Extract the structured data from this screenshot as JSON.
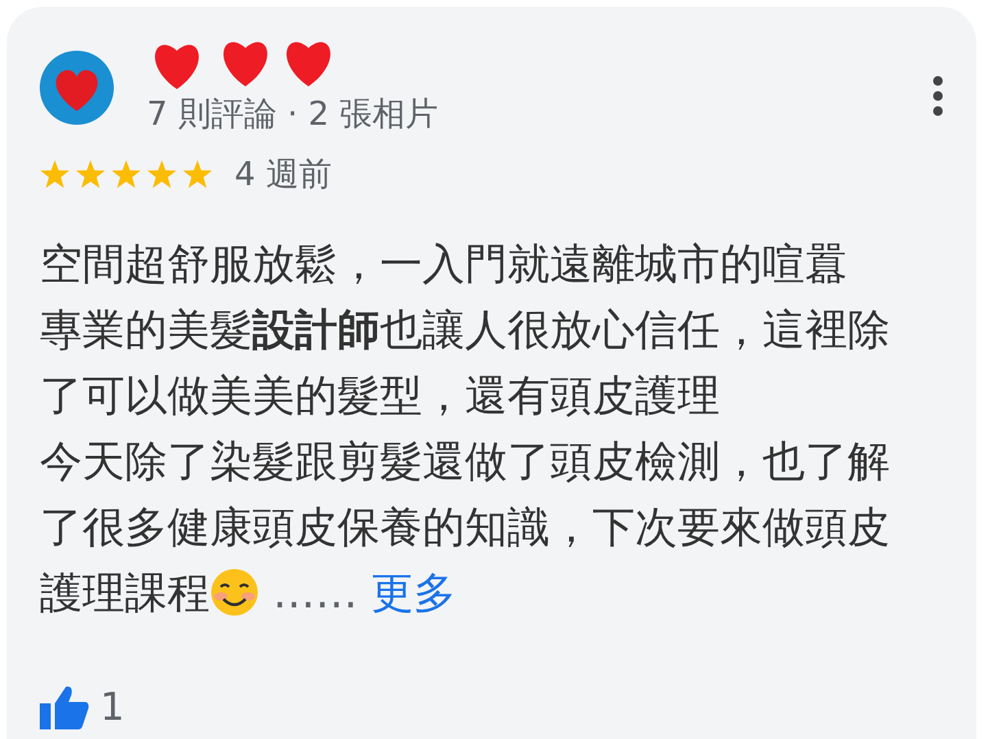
{
  "reviewer": {
    "stats": "7 則評論 · 2 張相片"
  },
  "rating": {
    "stars": 5,
    "time": "4 週前"
  },
  "review": {
    "paragraphs": [
      "空間超舒服放鬆，一入門就遠離城市的喧囂",
      "專業的美髮**設計師**也讓人很放心信任，這裡除了可以做美美的髮型，還有頭皮護理",
      "今天除了染髮跟剪髮還做了頭皮檢測，也了解了很多健康頭皮保養的知識，下次要來做頭皮護理課程"
    ],
    "ellipsis": "……",
    "more_link": "更多"
  },
  "likes": {
    "count": "1"
  }
}
